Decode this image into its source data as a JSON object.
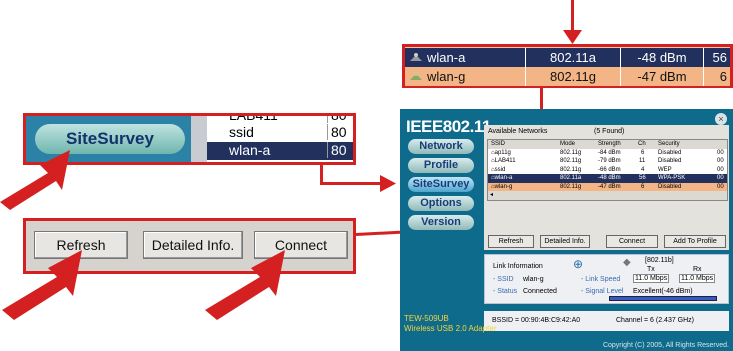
{
  "zoom_strip": {
    "rows": [
      {
        "ssid": "wlan-a",
        "mode": "802.11a",
        "strength": "-48 dBm",
        "ch": "56",
        "selected": true
      },
      {
        "ssid": "wlan-g",
        "mode": "802.11g",
        "strength": "-47 dBm",
        "ch": "6",
        "selected": false
      }
    ]
  },
  "zoom_nav": {
    "button_label": "SiteSurvey",
    "rows": [
      {
        "name": "LAB411",
        "value": "80"
      },
      {
        "name": "ssid",
        "value": "80"
      },
      {
        "name": "wlan-a",
        "value": "80"
      }
    ]
  },
  "zoom_buttons": {
    "refresh": "Refresh",
    "detailed": "Detailed Info.",
    "connect": "Connect"
  },
  "app": {
    "brand": "IEEE802.11",
    "nav": [
      "Network",
      "Profile",
      "SiteSurvey",
      "Options",
      "Version"
    ],
    "model_line1": "TEW-509UB",
    "model_line2": "Wireless USB 2.0 Adapter",
    "copyright": "Copyright (C) 2005, All Rights Reserved.",
    "panel": {
      "title": "Available Networks",
      "found": "(5 Found)",
      "columns": [
        "SSID",
        "Mode",
        "Strength",
        "Ch",
        "Security"
      ],
      "rows": [
        {
          "ssid": "ap11g",
          "mode": "802.11g",
          "strength": "-84 dBm",
          "ch": "6",
          "security": "Disabled",
          "extra": "00"
        },
        {
          "ssid": "LAB411",
          "mode": "802.11g",
          "strength": "-79 dBm",
          "ch": "11",
          "security": "Disabled",
          "extra": "00"
        },
        {
          "ssid": "ssid",
          "mode": "802.11g",
          "strength": "-66 dBm",
          "ch": "4",
          "security": "WEP",
          "extra": "00"
        },
        {
          "ssid": "wlan-a",
          "mode": "802.11a",
          "strength": "-48 dBm",
          "ch": "56",
          "security": "WPA-PSK",
          "extra": "00"
        },
        {
          "ssid": "wlan-g",
          "mode": "802.11g",
          "strength": "-47 dBm",
          "ch": "6",
          "security": "Disabled",
          "extra": "00"
        }
      ],
      "buttons": [
        "Refresh",
        "Detailed Info.",
        "Connect",
        "Add To Profile"
      ]
    },
    "link": {
      "title": "Link Information",
      "standard": "[802.11b]",
      "tx_label": "Tx",
      "rx_label": "Rx",
      "ssid_label": "- SSID",
      "ssid_value": "wlan-g",
      "status_label": "- Status",
      "status_value": "Connected",
      "speed_label": "- Link Speed",
      "tx_speed": "11.0 Mbps",
      "rx_speed": "11.0 Mbps",
      "signal_label": "- Signal Level",
      "signal_value": "Excellent(-46 dBm)"
    },
    "bssid": "BSSID = 00:90:4B:C9:42:A0",
    "channel": "Channel = 6 (2.437 GHz)"
  },
  "colors": {
    "accent": "#d42020",
    "selected_row": "#22305e",
    "highlight_row": "#f3b585",
    "app_bg": "#0e6b8c"
  }
}
